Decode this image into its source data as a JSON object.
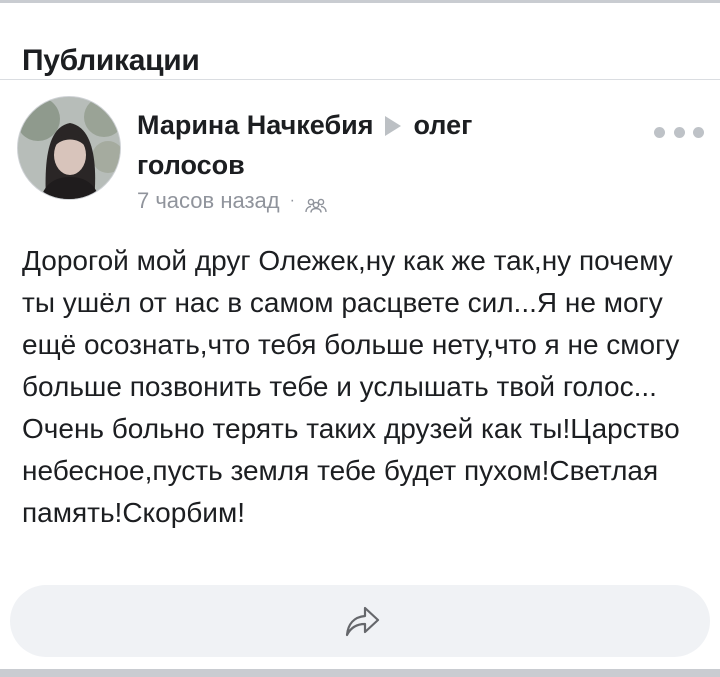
{
  "section": {
    "title": "Публикации"
  },
  "post": {
    "author": "Марина Начкебия",
    "recipient": "олег голосов",
    "timestamp": "7 часов назад",
    "separator": "·",
    "audience_icon": "friends-icon",
    "text": "Дорогой мой друг Олежек,ну как же так,ну почему ты ушёл от нас в самом расцвете сил...Я не могу ещё осознать,что тебя больше нету,что я не смогу больше позвонить тебе и услышать твой голос... Очень больно терять таких друзей как ты!Царство небесное,пусть земля тебе будет пухом!Светлая память!Скорбим!"
  },
  "actions": {
    "share_icon": "share-icon"
  },
  "colors": {
    "text": "#1c1e21",
    "meta": "#90949c",
    "action_bar": "#f0f2f5",
    "divider": "#c9ccd1"
  }
}
